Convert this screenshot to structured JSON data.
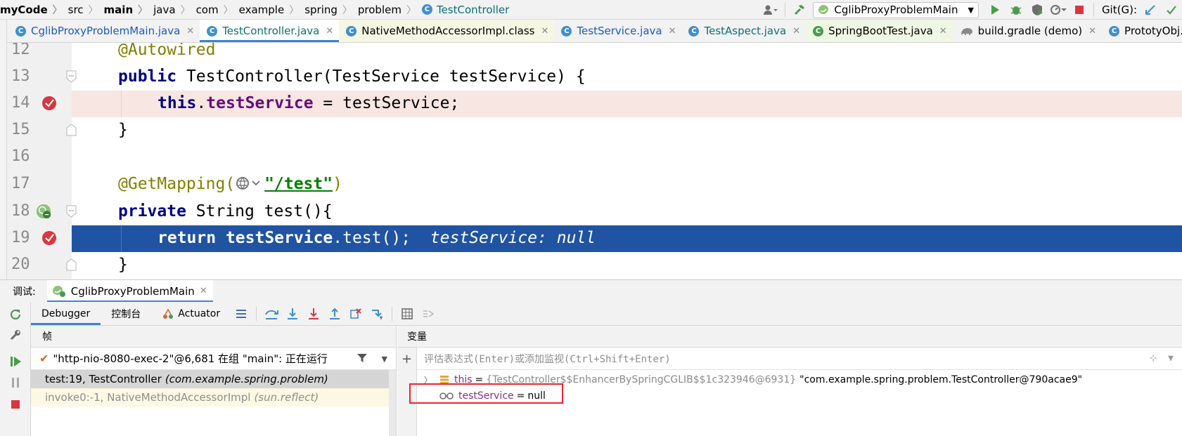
{
  "breadcrumb": [
    "myCode",
    "src",
    "main",
    "java",
    "com",
    "example",
    "spring",
    "problem",
    "TestController"
  ],
  "toolbar": {
    "run_config": "CglibProxyProblemMain",
    "git_label": "Git(G):"
  },
  "tabs": [
    {
      "label": "CglibProxyProblemMain.java",
      "kind": "class"
    },
    {
      "label": "TestController.java",
      "kind": "class"
    },
    {
      "label": "NativeMethodAccessorImpl.class",
      "kind": "class"
    },
    {
      "label": "TestService.java",
      "kind": "class"
    },
    {
      "label": "TestAspect.java",
      "kind": "class"
    },
    {
      "label": "SpringBootTest.java",
      "kind": "spring"
    },
    {
      "label": "build.gradle (demo)",
      "kind": "gradle"
    },
    {
      "label": "PrototyObj...",
      "kind": "class"
    }
  ],
  "editor": {
    "lines": [
      {
        "num": "12",
        "text": "@Autowired"
      },
      {
        "num": "13",
        "kw": "public",
        "text": " TestController(TestService testService) {"
      },
      {
        "num": "14",
        "kw": "this",
        "dot": ".",
        "field": "testService",
        "text": " = testService;"
      },
      {
        "num": "15",
        "text": "}"
      },
      {
        "num": "16",
        "text": ""
      },
      {
        "num": "17",
        "ann": "@GetMapping(",
        "str": "\"/test\"",
        "close": ")"
      },
      {
        "num": "18",
        "kw": "private",
        "text": " String test(){"
      },
      {
        "num": "19",
        "kw": "return",
        "bold": " testService",
        "text": ".test();",
        "inline": "testService: null"
      },
      {
        "num": "20",
        "text": "}"
      }
    ]
  },
  "debug": {
    "label": "调试:",
    "session": "CglibProxyProblemMain",
    "tabs": [
      "Debugger",
      "控制台",
      "Actuator"
    ],
    "frames_title": "帧",
    "thread": "\"http-nio-8080-exec-2\"@6,681 在组 \"main\": 正在运行",
    "frames": [
      {
        "method": "test:19, TestController",
        "pkg": "(com.example.spring.problem)"
      },
      {
        "method": "invoke0:-1, NativeMethodAccessorImpl",
        "pkg": "(sun.reflect)"
      }
    ],
    "vars_title": "变量",
    "watch_placeholder": "评估表达式(Enter)或添加监视(Ctrl+Shift+Enter)",
    "vars": [
      {
        "name": "this",
        "type": "{TestController$$EnhancerBySpringCGLIB$$1c323946@6931}",
        "value": "\"com.example.spring.problem.TestController@790acae9\""
      },
      {
        "name": "testService",
        "value": "null"
      }
    ]
  },
  "colors": {
    "accent": "#4083c9",
    "exec_line": "#2153a3",
    "bp_line": "#f8e6e2",
    "highlight": "#e8262b"
  }
}
